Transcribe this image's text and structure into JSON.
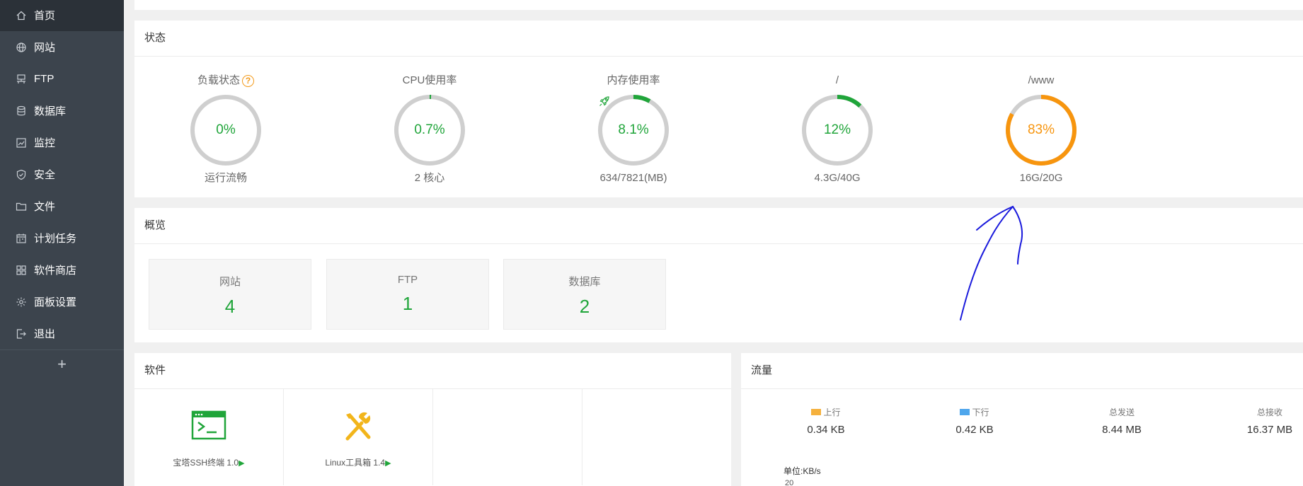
{
  "sidebar": {
    "items": [
      {
        "label": "首页",
        "icon": "home-icon",
        "active": true
      },
      {
        "label": "网站",
        "icon": "globe-icon"
      },
      {
        "label": "FTP",
        "icon": "ftp-icon"
      },
      {
        "label": "数据库",
        "icon": "database-icon"
      },
      {
        "label": "监控",
        "icon": "monitor-icon"
      },
      {
        "label": "安全",
        "icon": "shield-icon"
      },
      {
        "label": "文件",
        "icon": "folder-icon"
      },
      {
        "label": "计划任务",
        "icon": "calendar-icon"
      },
      {
        "label": "软件商店",
        "icon": "grid-icon"
      },
      {
        "label": "面板设置",
        "icon": "gear-icon"
      },
      {
        "label": "退出",
        "icon": "logout-icon"
      }
    ],
    "add_label": "+"
  },
  "status": {
    "title": "状态",
    "gauges": [
      {
        "label": "负载状态",
        "value": "0%",
        "percent": 0,
        "sub": "运行流畅",
        "color": "#20a53a",
        "help": "?"
      },
      {
        "label": "CPU使用率",
        "value": "0.7%",
        "percent": 0.7,
        "sub": "2 核心",
        "color": "#20a53a"
      },
      {
        "label": "内存使用率",
        "value": "8.1%",
        "percent": 8.1,
        "sub": "634/7821(MB)",
        "color": "#20a53a"
      },
      {
        "label": "/",
        "value": "12%",
        "percent": 12,
        "sub": "4.3G/40G",
        "color": "#20a53a"
      },
      {
        "label": "/www",
        "value": "83%",
        "percent": 83,
        "sub": "16G/20G",
        "color": "#f7950e"
      }
    ]
  },
  "overview": {
    "title": "概览",
    "cards": [
      {
        "name": "网站",
        "count": "4"
      },
      {
        "name": "FTP",
        "count": "1"
      },
      {
        "name": "数据库",
        "count": "2"
      }
    ]
  },
  "software": {
    "title": "软件",
    "items": [
      {
        "label": "宝塔SSH终端 1.0",
        "play": "▶",
        "icon": "terminal-icon"
      },
      {
        "label": "Linux工具箱 1.4",
        "play": "▶",
        "icon": "tools-icon"
      }
    ]
  },
  "traffic": {
    "title": "流量",
    "stats": [
      {
        "label": "上行",
        "value": "0.34 KB",
        "swatch": "#f5b13d"
      },
      {
        "label": "下行",
        "value": "0.42 KB",
        "swatch": "#4ea6ec"
      },
      {
        "label": "总发送",
        "value": "8.44 MB"
      },
      {
        "label": "总接收",
        "value": "16.37 MB"
      }
    ],
    "unit": "单位:KB/s",
    "first_tick": "20"
  },
  "colors": {
    "accent_green": "#20a53a",
    "warning_orange": "#f7950e",
    "sidebar_bg": "#3c444d",
    "annotation_blue": "#1a1adc"
  }
}
